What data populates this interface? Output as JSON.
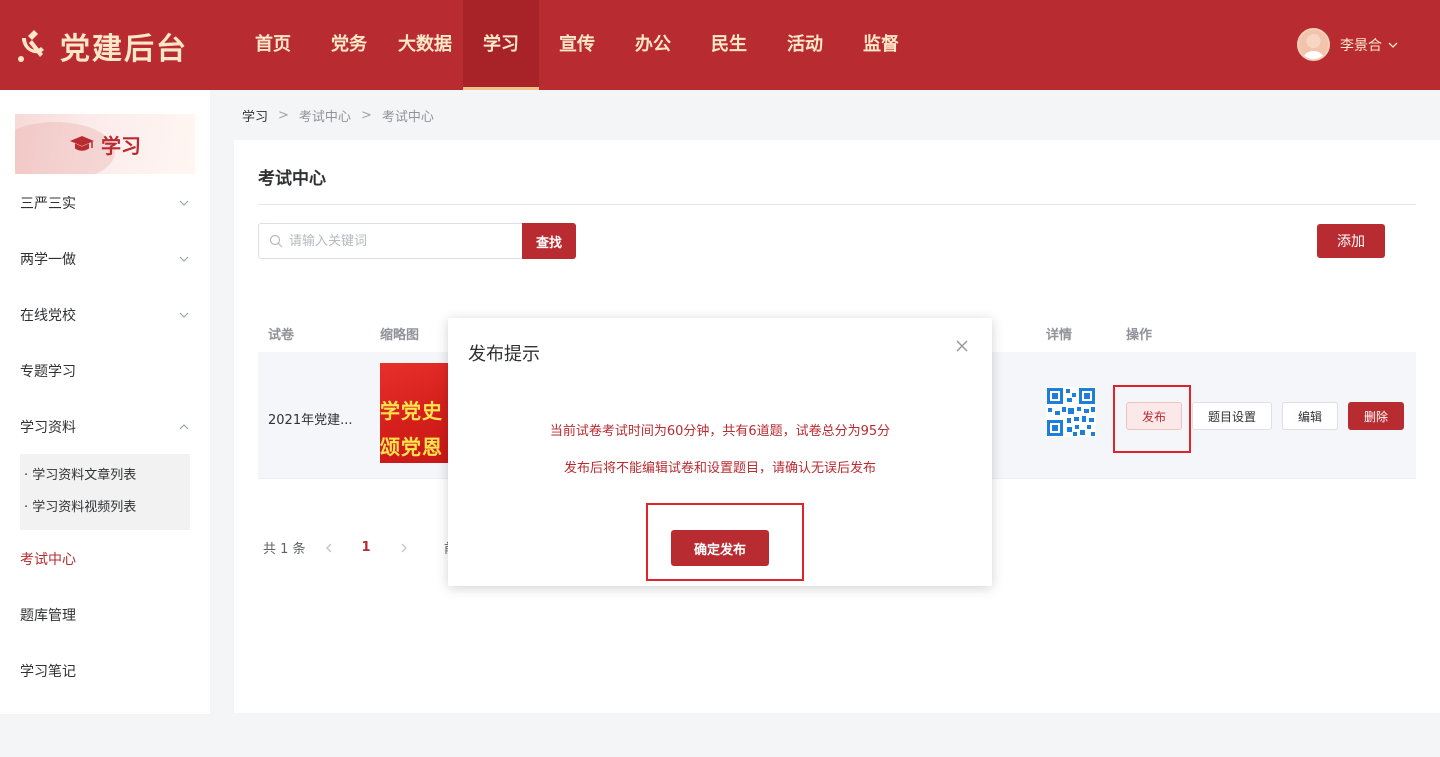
{
  "header": {
    "logo_text": "党建后台",
    "nav": [
      "首页",
      "党务",
      "大数据",
      "学习",
      "宣传",
      "办公",
      "民生",
      "活动",
      "监督"
    ],
    "active_nav": "学习",
    "user_name": "李景合"
  },
  "sidebar": {
    "banner_title": "学习",
    "items": [
      {
        "label": "三严三实",
        "arrow": "chevron-down"
      },
      {
        "label": "两学一做",
        "arrow": "chevron-down"
      },
      {
        "label": "在线党校",
        "arrow": "chevron-down"
      },
      {
        "label": "专题学习"
      },
      {
        "label": "学习资料",
        "arrow": "chevron-up"
      },
      {
        "label": "考试中心",
        "active": true
      },
      {
        "label": "题库管理"
      },
      {
        "label": "学习笔记"
      }
    ],
    "submenu": [
      "· 学习资料文章列表",
      "· 学习资料视频列表"
    ]
  },
  "breadcrumb": [
    "学习",
    "考试中心",
    "考试中心"
  ],
  "panel": {
    "title": "考试中心",
    "search_placeholder": "请输入关键词",
    "search_button": "查找",
    "add_button": "添加",
    "columns": [
      "试卷",
      "缩略图",
      "详情",
      "操作"
    ],
    "row": {
      "name": "2021年党建...",
      "thumbnail_text": [
        "学党史 知",
        "颂党恩 作"
      ],
      "ops": [
        "发布",
        "题目设置",
        "编辑",
        "删除"
      ]
    },
    "pager": {
      "total": "共 1 条",
      "page": "1",
      "goto": "前"
    }
  },
  "modal": {
    "title": "发布提示",
    "message1": "当前试卷考试时间为60分钟，共有6道题，试卷总分为95分",
    "message2": "发布后将不能编辑试卷和设置题目，请确认无误后发布",
    "confirm": "确定发布"
  },
  "colors": {
    "brand": "#b82c31",
    "header_text": "#fde7c9",
    "highlight_box": "#e0222a"
  }
}
